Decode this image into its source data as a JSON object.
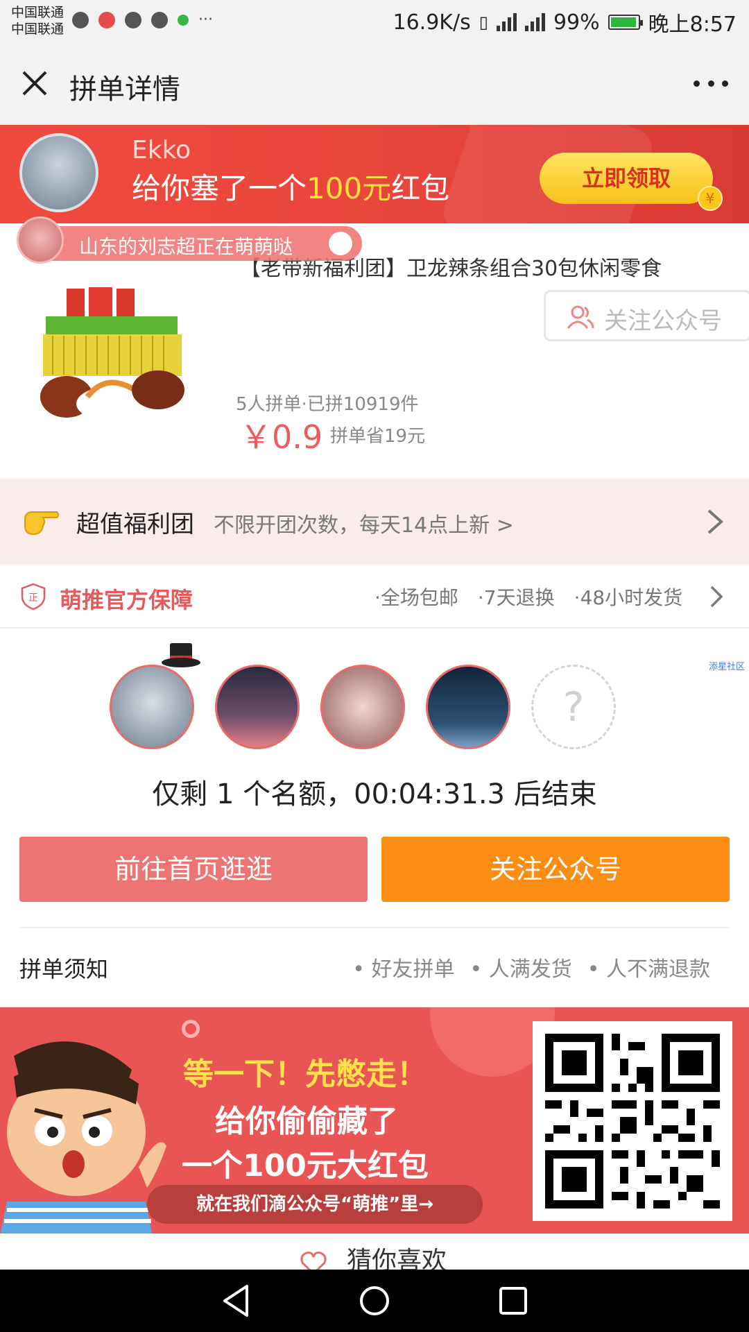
{
  "status_bar": {
    "carrier1": "中国联通",
    "carrier2": "中国联通",
    "more": "···",
    "speed": "16.9K/s",
    "net1": "2G",
    "net2": "4G",
    "battery": "99%",
    "time": "晚上8:57"
  },
  "nav": {
    "title": "拼单详情",
    "close_icon": "close-icon",
    "more_icon": "more-dots-icon"
  },
  "banner": {
    "name": "Ekko",
    "msg_pre": "给你塞了一个",
    "msg_amount": "100元",
    "msg_post": "红包",
    "button": "立即领取",
    "coin": "¥",
    "colors": {
      "bg": "#e8453c",
      "highlight": "#ffe03a",
      "button": "#f9c11a"
    }
  },
  "notify": {
    "text": "山东的刘志超正在萌萌哒"
  },
  "product": {
    "title": "【老带新福利团】卫龙辣条组合30包休闲零食",
    "follow_label": "关注公众号",
    "sold": "5人拼单·已拼10919件",
    "price": "￥0.9",
    "save": "拼单省19元"
  },
  "welfare": {
    "title": "超值福利团",
    "desc": "不限开团次数，每天14点上新 >"
  },
  "guarantee": {
    "title": "萌推官方保障",
    "badge": "正",
    "items": [
      "·全场包邮",
      "·7天退换",
      "·48小时发货"
    ]
  },
  "members": {
    "watermark": "添星社区",
    "empty_slot": "?",
    "countdown": "仅剩 1 个名额，00:04:31.3 后结束",
    "btn_home": "前往首页逛逛",
    "btn_follow": "关注公众号",
    "colors": {
      "home": "#ee7373",
      "follow": "#fb8d12"
    }
  },
  "notice": {
    "title": "拼单须知",
    "items": [
      "• 好友拼单",
      "• 人满发货",
      "• 人不满退款"
    ]
  },
  "promo": {
    "line1": "等一下！先憋走！",
    "line2": "给你偷偷藏了",
    "line3": "一个100元大红包",
    "pill": "就在我们滴公众号“萌推”里→"
  },
  "guess": {
    "text": "猜你喜欢"
  }
}
